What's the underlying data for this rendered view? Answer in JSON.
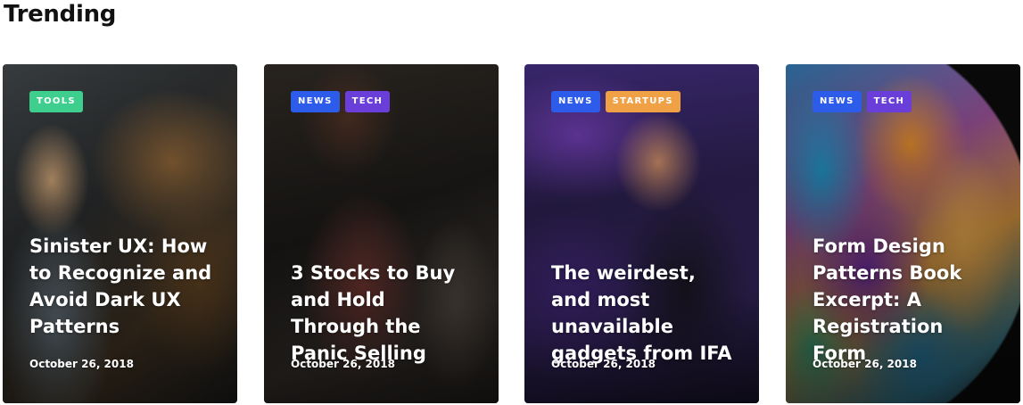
{
  "section": {
    "title": "Trending"
  },
  "colors": {
    "tools": "#3ecf8e",
    "news": "#2d5bea",
    "tech": "#6a3fd9",
    "startups": "#f0a045"
  },
  "cards": [
    {
      "tags": [
        {
          "label": "TOOLS",
          "color": "#3ecf8e"
        }
      ],
      "title": "Sinister UX: How to Recognize and Avoid Dark UX Patterns",
      "date": "October 26, 2018"
    },
    {
      "tags": [
        {
          "label": "NEWS",
          "color": "#2d5bea"
        },
        {
          "label": "TECH",
          "color": "#6a3fd9"
        }
      ],
      "title": "3 Stocks to Buy and Hold Through the Panic Selling",
      "date": "October 26, 2018"
    },
    {
      "tags": [
        {
          "label": "NEWS",
          "color": "#2d5bea"
        },
        {
          "label": "STARTUPS",
          "color": "#f0a045"
        }
      ],
      "title": "The weirdest, and most unavailable gadgets from IFA",
      "date": "October 26, 2018"
    },
    {
      "tags": [
        {
          "label": "NEWS",
          "color": "#2d5bea"
        },
        {
          "label": "TECH",
          "color": "#6a3fd9"
        }
      ],
      "title": "Form Design Patterns Book Excerpt: A Registration Form",
      "date": "October 26, 2018"
    }
  ]
}
